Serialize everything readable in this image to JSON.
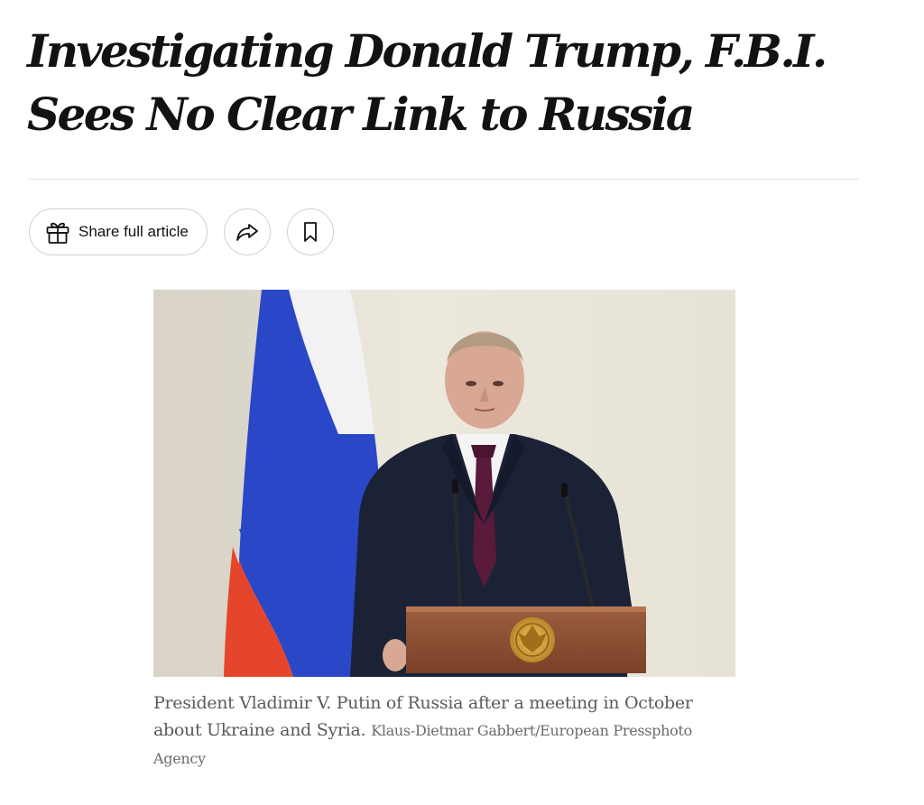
{
  "article": {
    "headline_line1": "Investigating Donald Trump, F.B.I.",
    "headline_line2": "Sees No Clear Link to Russia"
  },
  "share_bar": {
    "share_full_article_label": "Share full article",
    "icons": {
      "gift": "gift-icon",
      "share": "share-arrow-icon",
      "save": "bookmark-icon"
    }
  },
  "figure": {
    "caption": "President Vladimir V. Putin of Russia after a meeting in October about Ukraine and Syria.",
    "credit": "Klaus-Dietmar Gabbert/European Pressphoto Agency"
  },
  "colors": {
    "text": "#121212",
    "caption": "#5a5a5a",
    "divider": "#dfdfdf",
    "flag_white": "#f2f2f4",
    "flag_blue": "#2a47c8",
    "flag_red": "#e4452b"
  }
}
